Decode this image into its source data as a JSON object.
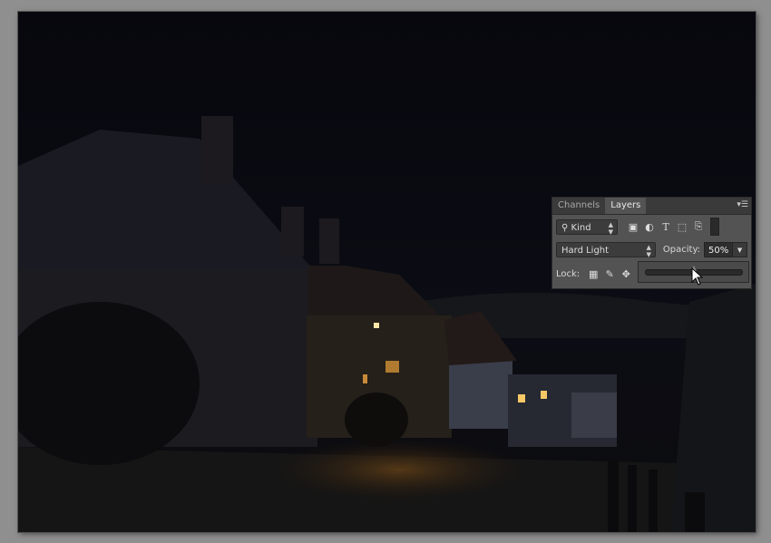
{
  "panel": {
    "tabs": [
      {
        "label": "Channels",
        "active": false
      },
      {
        "label": "Layers",
        "active": true
      }
    ],
    "menu_icon": "panel-menu-icon",
    "filter": {
      "kind_label": "Kind",
      "icons": [
        "image-filter-icon",
        "adjustment-filter-icon",
        "type-filter-icon",
        "shape-filter-icon",
        "smart-object-filter-icon",
        "filter-toggle-icon"
      ]
    },
    "blend_mode": "Hard Light",
    "opacity_label": "Opacity:",
    "opacity_value": "50%",
    "opacity_slider_fraction": 0.5,
    "lock_label": "Lock:",
    "lock_icons": [
      "lock-transparency-icon",
      "lock-pixels-icon",
      "lock-position-icon"
    ]
  },
  "colors": {
    "window_light": "#f6c866",
    "canvas_bg": "#0a0b12",
    "workspace": "#8f8f8f",
    "panel_bg": "#535353"
  }
}
